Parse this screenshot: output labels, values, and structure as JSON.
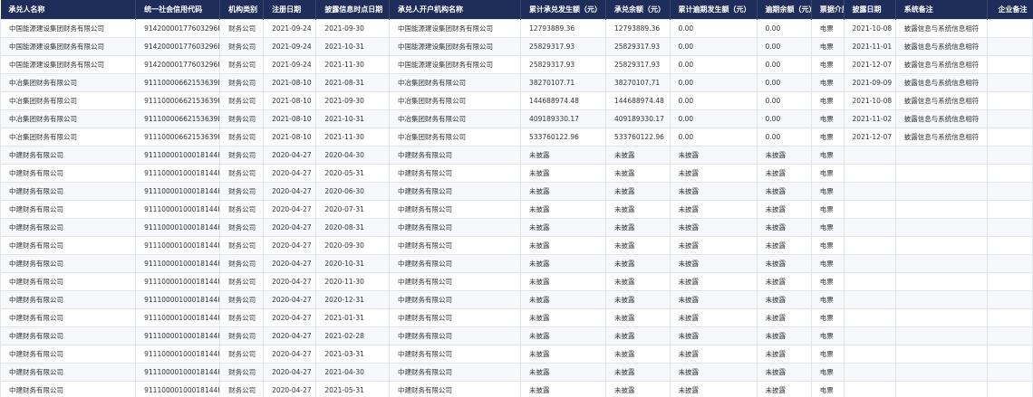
{
  "columns": [
    "承兑人名称",
    "统一社会信用代码",
    "机构类别",
    "注册日期",
    "披露信息时点日期",
    "承兑人开户机构名称",
    "累计承兑发生额（元）",
    "承兑余额（元）",
    "累计逾期发生额（元）",
    "逾期余额（元）",
    "票据介质",
    "披露日期",
    "系统备注",
    "企业备注"
  ],
  "rows": [
    [
      "中国能源建设集团财务有限公司",
      "91420000177603296B",
      "财务公司",
      "2021-09-24",
      "2021-09-30",
      "中国能源建设集团财务有限公司",
      "12793889.36",
      "12793889.36",
      "0.00",
      "0.00",
      "电票",
      "2021-10-08",
      "披露信息与系统信息相符",
      ""
    ],
    [
      "中国能源建设集团财务有限公司",
      "91420000177603296B",
      "财务公司",
      "2021-09-24",
      "2021-10-31",
      "中国能源建设集团财务有限公司",
      "25829317.93",
      "25829317.93",
      "0.00",
      "0.00",
      "电票",
      "2021-11-01",
      "披露信息与系统信息相符",
      ""
    ],
    [
      "中国能源建设集团财务有限公司",
      "91420000177603296B",
      "财务公司",
      "2021-09-24",
      "2021-11-30",
      "中国能源建设集团财务有限公司",
      "25829317.93",
      "25829317.93",
      "0.00",
      "0.00",
      "电票",
      "2021-12-07",
      "披露信息与系统信息相符",
      ""
    ],
    [
      "中冶集团财务有限公司",
      "91110000662153639B",
      "财务公司",
      "2021-08-10",
      "2021-08-31",
      "中冶集团财务有限公司",
      "38270107.71",
      "38270107.71",
      "0.00",
      "0.00",
      "电票",
      "2021-09-09",
      "披露信息与系统信息相符",
      ""
    ],
    [
      "中冶集团财务有限公司",
      "91110000662153639B",
      "财务公司",
      "2021-08-10",
      "2021-09-30",
      "中冶集团财务有限公司",
      "144688974.48",
      "144688974.48",
      "0.00",
      "0.00",
      "电票",
      "2021-10-08",
      "披露信息与系统信息相符",
      ""
    ],
    [
      "中冶集团财务有限公司",
      "91110000662153639B",
      "财务公司",
      "2021-08-10",
      "2021-10-31",
      "中冶集团财务有限公司",
      "409189330.17",
      "409189330.17",
      "0.00",
      "0.00",
      "电票",
      "2021-11-02",
      "披露信息与系统信息相符",
      ""
    ],
    [
      "中冶集团财务有限公司",
      "91110000662153639B",
      "财务公司",
      "2021-08-10",
      "2021-11-30",
      "中冶集团财务有限公司",
      "533760122.96",
      "533760122.96",
      "0.00",
      "0.00",
      "电票",
      "2021-12-07",
      "披露信息与系统信息相符",
      ""
    ],
    [
      "中建财务有限公司",
      "91110000100018144H",
      "财务公司",
      "2020-04-27",
      "2020-04-30",
      "中建财务有限公司",
      "未披露",
      "未披露",
      "未披露",
      "未披露",
      "电票",
      "",
      "",
      ""
    ],
    [
      "中建财务有限公司",
      "91110000100018144H",
      "财务公司",
      "2020-04-27",
      "2020-05-31",
      "中建财务有限公司",
      "未披露",
      "未披露",
      "未披露",
      "未披露",
      "电票",
      "",
      "",
      ""
    ],
    [
      "中建财务有限公司",
      "91110000100018144H",
      "财务公司",
      "2020-04-27",
      "2020-06-30",
      "中建财务有限公司",
      "未披露",
      "未披露",
      "未披露",
      "未披露",
      "电票",
      "",
      "",
      ""
    ],
    [
      "中建财务有限公司",
      "91110000100018144H",
      "财务公司",
      "2020-04-27",
      "2020-07-31",
      "中建财务有限公司",
      "未披露",
      "未披露",
      "未披露",
      "未披露",
      "电票",
      "",
      "",
      ""
    ],
    [
      "中建财务有限公司",
      "91110000100018144H",
      "财务公司",
      "2020-04-27",
      "2020-08-31",
      "中建财务有限公司",
      "未披露",
      "未披露",
      "未披露",
      "未披露",
      "电票",
      "",
      "",
      ""
    ],
    [
      "中建财务有限公司",
      "91110000100018144H",
      "财务公司",
      "2020-04-27",
      "2020-09-30",
      "中建财务有限公司",
      "未披露",
      "未披露",
      "未披露",
      "未披露",
      "电票",
      "",
      "",
      ""
    ],
    [
      "中建财务有限公司",
      "91110000100018144H",
      "财务公司",
      "2020-04-27",
      "2020-10-31",
      "中建财务有限公司",
      "未披露",
      "未披露",
      "未披露",
      "未披露",
      "电票",
      "",
      "",
      ""
    ],
    [
      "中建财务有限公司",
      "91110000100018144H",
      "财务公司",
      "2020-04-27",
      "2020-11-30",
      "中建财务有限公司",
      "未披露",
      "未披露",
      "未披露",
      "未披露",
      "电票",
      "",
      "",
      ""
    ],
    [
      "中建财务有限公司",
      "91110000100018144H",
      "财务公司",
      "2020-04-27",
      "2020-12-31",
      "中建财务有限公司",
      "未披露",
      "未披露",
      "未披露",
      "未披露",
      "电票",
      "",
      "",
      ""
    ],
    [
      "中建财务有限公司",
      "91110000100018144H",
      "财务公司",
      "2020-04-27",
      "2021-01-31",
      "中建财务有限公司",
      "未披露",
      "未披露",
      "未披露",
      "未披露",
      "电票",
      "",
      "",
      ""
    ],
    [
      "中建财务有限公司",
      "91110000100018144H",
      "财务公司",
      "2020-04-27",
      "2021-02-28",
      "中建财务有限公司",
      "未披露",
      "未披露",
      "未披露",
      "未披露",
      "电票",
      "",
      "",
      ""
    ],
    [
      "中建财务有限公司",
      "91110000100018144H",
      "财务公司",
      "2020-04-27",
      "2021-03-31",
      "中建财务有限公司",
      "未披露",
      "未披露",
      "未披露",
      "未披露",
      "电票",
      "",
      "",
      ""
    ],
    [
      "中建财务有限公司",
      "91110000100018144H",
      "财务公司",
      "2020-04-27",
      "2021-04-30",
      "中建财务有限公司",
      "未披露",
      "未披露",
      "未披露",
      "未披露",
      "电票",
      "",
      "",
      ""
    ],
    [
      "中建财务有限公司",
      "91110000100018144H",
      "财务公司",
      "2020-04-27",
      "2021-05-31",
      "中建财务有限公司",
      "未披露",
      "未披露",
      "未披露",
      "未披露",
      "电票",
      "",
      "",
      ""
    ]
  ]
}
